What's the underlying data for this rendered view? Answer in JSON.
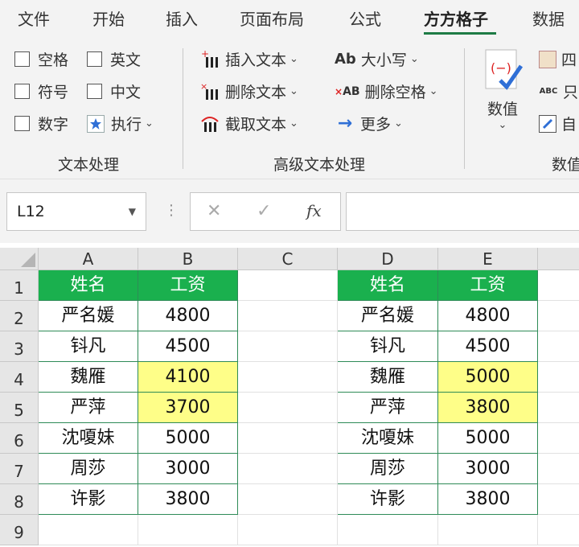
{
  "ribbon": {
    "tabs": [
      "文件",
      "开始",
      "插入",
      "页面布局",
      "公式",
      "方方格子",
      "数据"
    ],
    "active_tab": "方方格子",
    "text_group": {
      "checkbox_space": "空格",
      "checkbox_english": "英文",
      "checkbox_symbol": "符号",
      "checkbox_chinese": "中文",
      "checkbox_number": "数字",
      "execute": "执行",
      "label": "文本处理"
    },
    "adv_group": {
      "insert_text": "插入文本",
      "delete_text": "删除文本",
      "extract_text": "截取文本",
      "case": "大小写",
      "delete_space": "删除空格",
      "more": "更多",
      "label": "高级文本处理"
    },
    "num_group": {
      "value_button": "数值",
      "item1": "四",
      "item2": "只",
      "item3": "自",
      "label": "数值"
    }
  },
  "formula_bar": {
    "name_box": "L12",
    "cancel": "✕",
    "confirm": "✓",
    "fx": "fx",
    "formula": ""
  },
  "sheet": {
    "columns": [
      "A",
      "B",
      "C",
      "D",
      "E"
    ],
    "rows": [
      "1",
      "2",
      "3",
      "4",
      "5",
      "6",
      "7",
      "8",
      "9"
    ],
    "table1": {
      "headers": [
        "姓名",
        "工资"
      ],
      "rows": [
        [
          "严名媛",
          "4800"
        ],
        [
          "钭凡",
          "4500"
        ],
        [
          "魏雁",
          "4100"
        ],
        [
          "严萍",
          "3700"
        ],
        [
          "沈嗄妹",
          "5000"
        ],
        [
          "周莎",
          "3000"
        ],
        [
          "许影",
          "3800"
        ]
      ]
    },
    "table2": {
      "headers": [
        "姓名",
        "工资"
      ],
      "rows": [
        [
          "严名媛",
          "4800"
        ],
        [
          "钭凡",
          "4500"
        ],
        [
          "魏雁",
          "5000"
        ],
        [
          "严萍",
          "3800"
        ],
        [
          "沈嗄妹",
          "5000"
        ],
        [
          "周莎",
          "3000"
        ],
        [
          "许影",
          "3800"
        ]
      ]
    },
    "colors": {
      "header_bg": "#1ab04e",
      "highlight": "#fefe88",
      "accent": "#1e7b45"
    }
  }
}
